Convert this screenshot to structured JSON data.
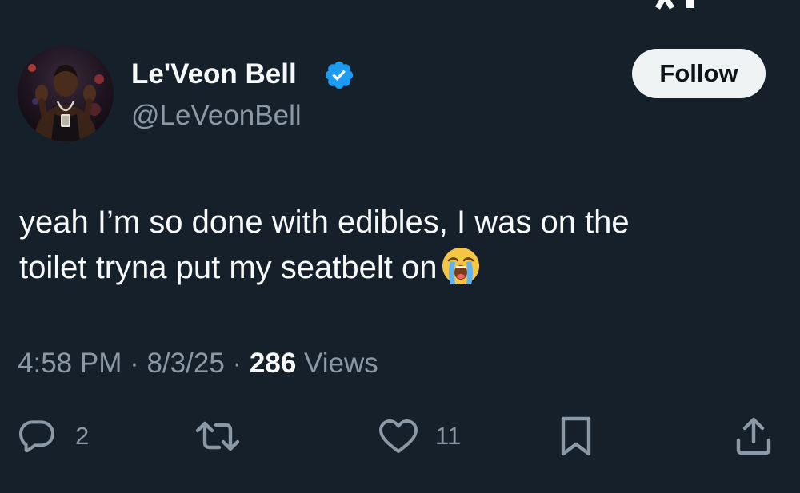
{
  "top_bar": {
    "back_icon": "chevron-left-icon",
    "logo_icon": "x-logo-icon"
  },
  "author": {
    "display_name": "Le'Veon Bell",
    "handle": "@LeVeonBell",
    "verified": true,
    "verified_color": "#1d9bf0"
  },
  "follow_button": {
    "label": "Follow"
  },
  "tweet": {
    "text_line1": "yeah I’m so done with edibles, I was on the",
    "text_line2": "toilet tryna put my seatbelt on",
    "emoji": "loudly-crying-face-emoji"
  },
  "meta": {
    "time": "4:58 PM",
    "separator1": " · ",
    "date": "8/3/25",
    "separator2": " · ",
    "views_count": "286",
    "views_label": " Views"
  },
  "actions": {
    "reply": {
      "icon": "reply-icon",
      "count": "2"
    },
    "repost": {
      "icon": "repost-icon",
      "count": ""
    },
    "like": {
      "icon": "heart-icon",
      "count": "11"
    },
    "bookmark": {
      "icon": "bookmark-icon"
    },
    "share": {
      "icon": "share-icon"
    }
  },
  "colors": {
    "background": "#15202b",
    "primary_text": "#f7f9f9",
    "secondary_text": "#8b98a5",
    "follow_bg": "#eff3f4",
    "follow_text": "#0f1419"
  }
}
